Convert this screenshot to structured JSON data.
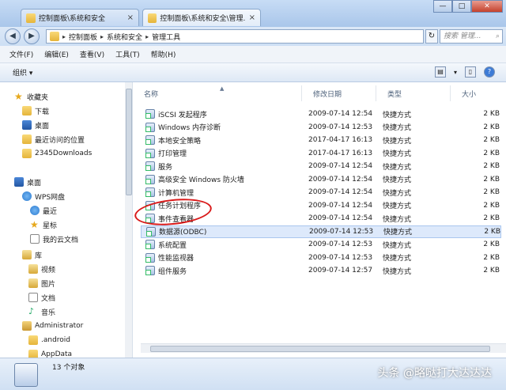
{
  "tabs": [
    {
      "title": "控制面板\\系统和安全",
      "close": "×",
      "active": false
    },
    {
      "title": "控制面板\\系统和安全\\管理...",
      "close": "×",
      "active": true
    }
  ],
  "window_controls": {
    "minimize": "—",
    "maximize": "□",
    "close": "✕"
  },
  "address": {
    "crumbs": [
      "控制面板",
      "系统和安全",
      "管理工具"
    ],
    "search_placeholder": "搜索 管理..."
  },
  "menu": [
    "文件(F)",
    "编辑(E)",
    "查看(V)",
    "工具(T)",
    "帮助(H)"
  ],
  "toolbar": {
    "organize": "组织 ▾"
  },
  "nav": [
    {
      "label": "收藏夹",
      "icon": "star"
    },
    {
      "label": "下载",
      "icon": "folder"
    },
    {
      "label": "桌面",
      "icon": "desk"
    },
    {
      "label": "最近访问的位置",
      "icon": "folder"
    },
    {
      "label": "2345Downloads",
      "icon": "folder"
    },
    {
      "label": "桌面",
      "icon": "desk"
    },
    {
      "label": "WPS网盘",
      "icon": "cloud"
    },
    {
      "label": "最近",
      "icon": "cloud"
    },
    {
      "label": "星标",
      "icon": "star"
    },
    {
      "label": "我的云文档",
      "icon": "doc"
    },
    {
      "label": "库",
      "icon": "lib"
    },
    {
      "label": "视频",
      "icon": "lib"
    },
    {
      "label": "图片",
      "icon": "lib"
    },
    {
      "label": "文档",
      "icon": "doc"
    },
    {
      "label": "音乐",
      "icon": "music"
    },
    {
      "label": "Administrator",
      "icon": "user"
    },
    {
      "label": ".android",
      "icon": "folder"
    },
    {
      "label": "AppData",
      "icon": "folder"
    }
  ],
  "columns": {
    "name": "名称",
    "date": "修改日期",
    "type": "类型",
    "size": "大小"
  },
  "files": [
    {
      "name": "iSCSI 发起程序",
      "date": "2009-07-14 12:54",
      "type": "快捷方式",
      "size": "2 KB"
    },
    {
      "name": "Windows 内存诊断",
      "date": "2009-07-14 12:53",
      "type": "快捷方式",
      "size": "2 KB"
    },
    {
      "name": "本地安全策略",
      "date": "2017-04-17 16:13",
      "type": "快捷方式",
      "size": "2 KB"
    },
    {
      "name": "打印管理",
      "date": "2017-04-17 16:13",
      "type": "快捷方式",
      "size": "2 KB"
    },
    {
      "name": "服务",
      "date": "2009-07-14 12:54",
      "type": "快捷方式",
      "size": "2 KB"
    },
    {
      "name": "高级安全 Windows 防火墙",
      "date": "2009-07-14 12:54",
      "type": "快捷方式",
      "size": "2 KB"
    },
    {
      "name": "计算机管理",
      "date": "2009-07-14 12:54",
      "type": "快捷方式",
      "size": "2 KB"
    },
    {
      "name": "任务计划程序",
      "date": "2009-07-14 12:54",
      "type": "快捷方式",
      "size": "2 KB"
    },
    {
      "name": "事件查看器",
      "date": "2009-07-14 12:54",
      "type": "快捷方式",
      "size": "2 KB"
    },
    {
      "name": "数据源(ODBC)",
      "date": "2009-07-14 12:53",
      "type": "快捷方式",
      "size": "2 KB"
    },
    {
      "name": "系统配置",
      "date": "2009-07-14 12:53",
      "type": "快捷方式",
      "size": "2 KB"
    },
    {
      "name": "性能监视器",
      "date": "2009-07-14 12:53",
      "type": "快捷方式",
      "size": "2 KB"
    },
    {
      "name": "组件服务",
      "date": "2009-07-14 12:57",
      "type": "快捷方式",
      "size": "2 KB"
    }
  ],
  "selected_file_index": 9,
  "status": {
    "count": "13 个对象"
  },
  "watermark": "头条 @略哒打大达达达"
}
